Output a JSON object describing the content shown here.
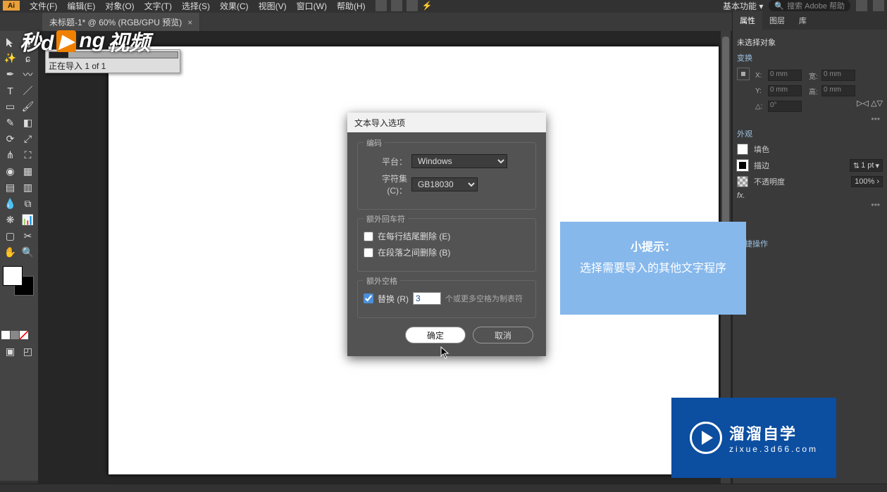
{
  "menu": {
    "items": [
      "文件(F)",
      "编辑(E)",
      "对象(O)",
      "文字(T)",
      "选择(S)",
      "效果(C)",
      "视图(V)",
      "窗口(W)",
      "帮助(H)"
    ],
    "workspace": "基本功能",
    "search_placeholder": "搜索 Adobe 帮助"
  },
  "tab": {
    "title": "未标题-1* @ 60% (RGB/GPU 预览)"
  },
  "import_tip": {
    "text": "正在导入 1 of 1"
  },
  "dialog": {
    "title": "文本导入选项",
    "encoding_legend": "编码",
    "platform_label": "平台：",
    "platform_value": "Windows",
    "charset_label": "字符集 (C)：",
    "charset_value": "GB18030",
    "crlf_legend": "额外回车符",
    "crlf_opt1": "在每行结尾删除 (E)",
    "crlf_opt1_checked": false,
    "crlf_opt2": "在段落之间删除 (B)",
    "crlf_opt2_checked": false,
    "spaces_legend": "额外空格",
    "replace_label": "替换 (R)",
    "replace_checked": true,
    "replace_value": "3",
    "replace_suffix": "个或更多空格为制表符",
    "ok": "确定",
    "cancel": "取消"
  },
  "hint": {
    "title": "小提示：",
    "body": "选择需要导入的其他文字程序"
  },
  "panels": {
    "tabs": [
      "属性",
      "图层",
      "库"
    ],
    "no_selection": "未选择对象",
    "transform_title": "变换",
    "x_label": "X:",
    "y_label": "Y:",
    "w_label": "宽:",
    "h_label": "高:",
    "dim_value": "0 mm",
    "angle_label": "△:",
    "angle_value": "0°",
    "appearance_title": "外观",
    "fill_label": "填色",
    "stroke_label": "描边",
    "stroke_value": "1 pt",
    "opacity_label": "不透明度",
    "opacity_value": "100%",
    "quick_title": "快捷操作"
  },
  "watermark_top": {
    "a": "秒d",
    "b": "ng",
    "c": "视频"
  },
  "watermark_bottom": {
    "line1": "溜溜自学",
    "line2": "zixue.3d66.com"
  }
}
